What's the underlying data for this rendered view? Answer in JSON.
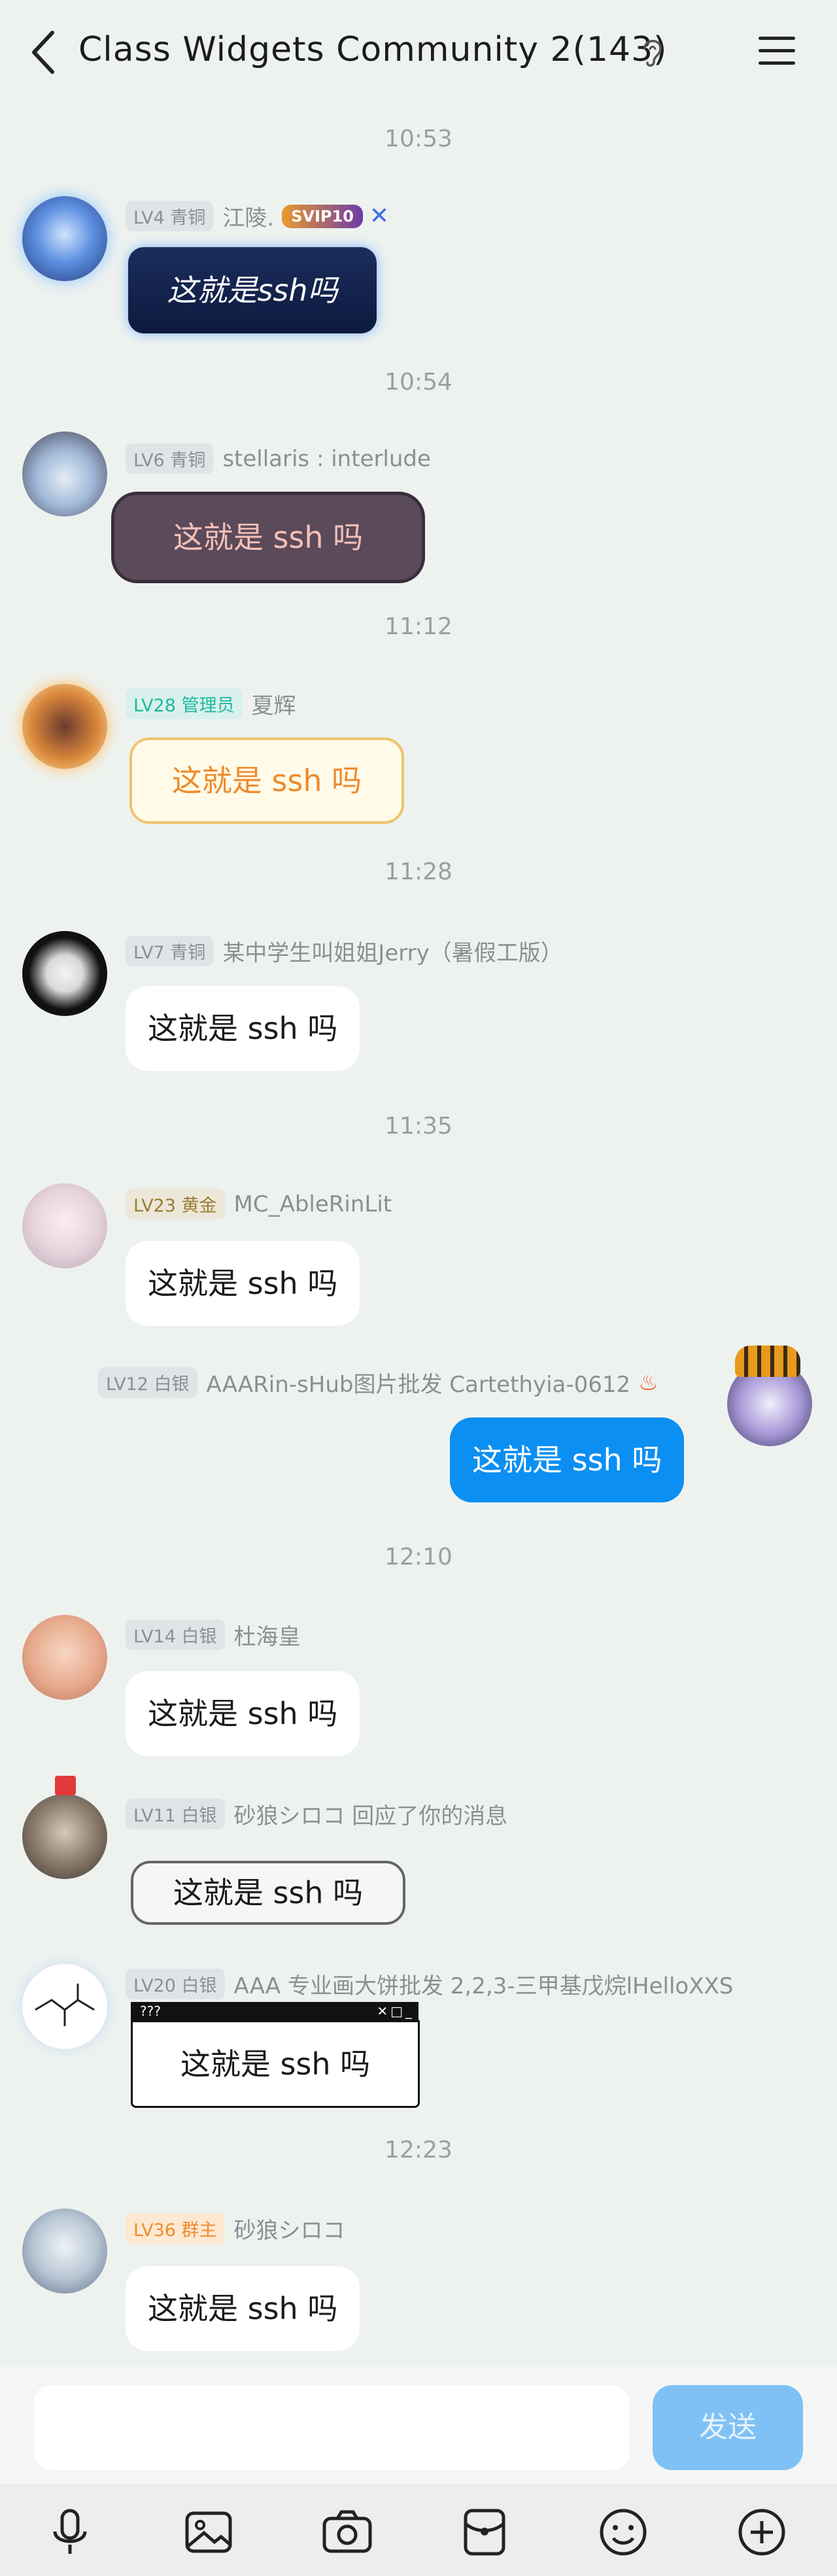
{
  "header": {
    "title": "Class Widgets Community 2(143)"
  },
  "times": [
    "10:53",
    "10:54",
    "11:12",
    "11:28",
    "11:35",
    "12:10",
    "12:23"
  ],
  "messages": [
    {
      "level": "LV4 青铜",
      "name": "江陵.",
      "badge": "SVIP10",
      "text": "这就是ssh吗"
    },
    {
      "level": "LV6 青铜",
      "name": "stellaris : interlude",
      "text": "这就是 ssh 吗"
    },
    {
      "level": "LV28 管理员",
      "name": "夏辉",
      "text": "这就是 ssh 吗"
    },
    {
      "level": "LV7 青铜",
      "name": "某中学生叫姐姐Jerry（暑假工版）",
      "text": "这就是 ssh 吗"
    },
    {
      "level": "LV23 黄金",
      "name": "MC_AbleRinLit",
      "text": "这就是 ssh 吗"
    },
    {
      "level": "LV12 白银",
      "name": "AAARin-sHub图片批发 Cartethyia-0612",
      "text": "这就是 ssh 吗"
    },
    {
      "level": "LV14 白银",
      "name": "杜海皇",
      "text": "这就是 ssh 吗"
    },
    {
      "level": "LV11 白银",
      "name": "砂狼シロコ  回应了你的消息",
      "text": "这就是 ssh 吗"
    },
    {
      "level": "LV20 白银",
      "name": "AAA 专业画大饼批发 2,2,3-三甲基戊烷lHelloXXS",
      "text": "这就是 ssh 吗",
      "frame_title": "???"
    },
    {
      "level": "LV36 群主",
      "name": "砂狼シロコ",
      "text": "这就是 ssh 吗"
    }
  ],
  "composer": {
    "send_label": "发送"
  },
  "colors": {
    "self_bubble": "#0c8ff2",
    "send_button": "#7fc1f4",
    "background": "#eef2ef"
  }
}
